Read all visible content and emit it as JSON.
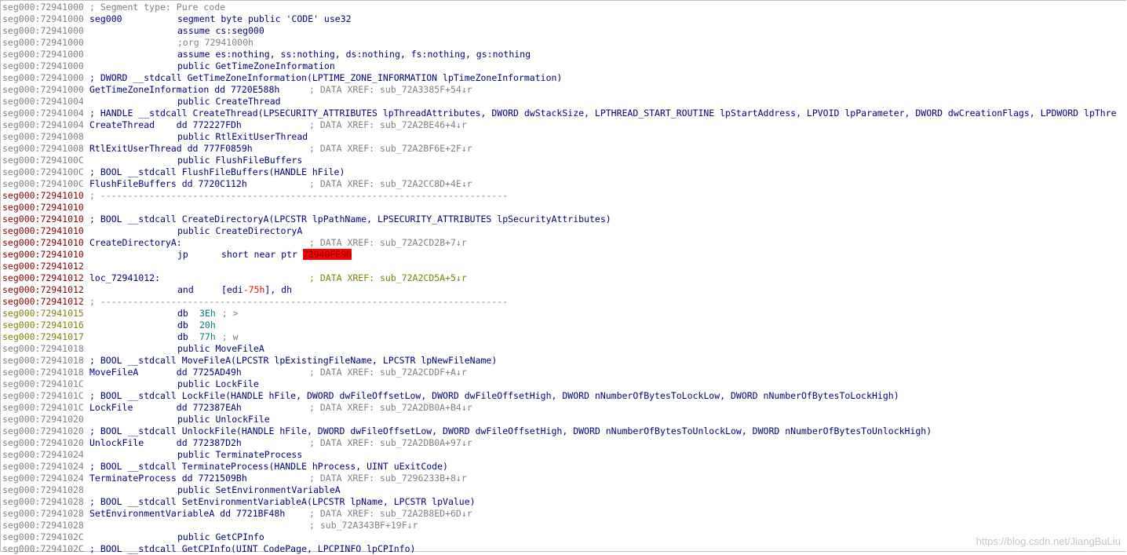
{
  "listing": [
    {
      "addr": "seg000:72941000",
      "kind": "comment",
      "text": "; Segment type: Pure code"
    },
    {
      "addr": "seg000:72941000",
      "kind": "instr",
      "label": "seg000",
      "op": "segment byte public 'CODE' use32",
      "args": ""
    },
    {
      "addr": "seg000:72941000",
      "kind": "instr",
      "label": "",
      "op": "assume cs:seg000",
      "args": ""
    },
    {
      "addr": "seg000:72941000",
      "kind": "instr",
      "label": "",
      "op": ";org 72941000h",
      "args": "",
      "opgray": true
    },
    {
      "addr": "seg000:72941000",
      "kind": "instr",
      "label": "",
      "op": "assume es:nothing, ss:nothing, ds:nothing, fs:nothing, gs:nothing",
      "args": ""
    },
    {
      "addr": "seg000:72941000",
      "kind": "instr",
      "label": "",
      "op": "public GetTimeZoneInformation",
      "args": ""
    },
    {
      "addr": "seg000:72941000",
      "kind": "sig",
      "text": "; DWORD __stdcall GetTimeZoneInformation(LPTIME_ZONE_INFORMATION lpTimeZoneInformation)"
    },
    {
      "addr": "seg000:72941000",
      "kind": "data",
      "label": "GetTimeZoneInformation dd 7720E588h",
      "xref": "; DATA XREF: sub_72A3385F+54↓r"
    },
    {
      "addr": "seg000:72941004",
      "kind": "instr",
      "label": "",
      "op": "public CreateThread",
      "args": ""
    },
    {
      "addr": "seg000:72941004",
      "kind": "sig",
      "text": "; HANDLE __stdcall CreateThread(LPSECURITY_ATTRIBUTES lpThreadAttributes, DWORD dwStackSize, LPTHREAD_START_ROUTINE lpStartAddress, LPVOID lpParameter, DWORD dwCreationFlags, LPDWORD lpThre"
    },
    {
      "addr": "seg000:72941004",
      "kind": "data",
      "label": "CreateThread    dd 772227FDh",
      "xref": "; DATA XREF: sub_72A2BE46+4↓r"
    },
    {
      "addr": "seg000:72941008",
      "kind": "instr",
      "label": "",
      "op": "public RtlExitUserThread",
      "args": ""
    },
    {
      "addr": "seg000:72941008",
      "kind": "data",
      "label": "RtlExitUserThread dd 777F0859h",
      "xref": "; DATA XREF: sub_72A2BF6E+2F↓r"
    },
    {
      "addr": "seg000:7294100C",
      "kind": "instr",
      "label": "",
      "op": "public FlushFileBuffers",
      "args": ""
    },
    {
      "addr": "seg000:7294100C",
      "kind": "sig",
      "text": "; BOOL __stdcall FlushFileBuffers(HANDLE hFile)"
    },
    {
      "addr": "seg000:7294100C",
      "kind": "data",
      "label": "FlushFileBuffers dd 7720C112h",
      "xref": "; DATA XREF: sub_72A2CC8D+4E↓r"
    },
    {
      "addr": "seg000:72941010",
      "kind": "sep",
      "addrclass": "code",
      "text": "; ---------------------------------------------------------------------------"
    },
    {
      "addr": "seg000:72941010",
      "kind": "blank",
      "addrclass": "code"
    },
    {
      "addr": "seg000:72941010",
      "kind": "sig",
      "addrclass": "code",
      "text": "; BOOL __stdcall CreateDirectoryA(LPCSTR lpPathName, LPSECURITY_ATTRIBUTES lpSecurityAttributes)"
    },
    {
      "addr": "seg000:72941010",
      "kind": "instr",
      "addrclass": "code",
      "label": "",
      "op": "public CreateDirectoryA",
      "args": ""
    },
    {
      "addr": "seg000:72941010",
      "kind": "data",
      "addrclass": "code",
      "label": "CreateDirectoryA:",
      "xref": "; DATA XREF: sub_72A2CD2B+7↓r"
    },
    {
      "addr": "seg000:72941010",
      "kind": "jmp",
      "addrclass": "code",
      "op": "jp",
      "args": "short near ptr ",
      "target": "72940FE9h"
    },
    {
      "addr": "seg000:72941012",
      "kind": "blank",
      "addrclass": "code"
    },
    {
      "addr": "seg000:72941012",
      "kind": "data",
      "addrclass": "code",
      "label": "loc_72941012:",
      "xref": "; DATA XREF: sub_72A2CD5A+5↓r",
      "xrefcode": true
    },
    {
      "addr": "seg000:72941012",
      "kind": "jmp",
      "addrclass": "code",
      "op": "and",
      "args": "[edi-75h], dh",
      "argsred": "-75h"
    },
    {
      "addr": "seg000:72941012",
      "kind": "sep",
      "addrclass": "code",
      "text": "; ---------------------------------------------------------------------------"
    },
    {
      "addr": "seg000:72941015",
      "kind": "db",
      "addrclass": "data",
      "op": "db",
      "val": "3Eh",
      "hint": "; >"
    },
    {
      "addr": "seg000:72941016",
      "kind": "db",
      "addrclass": "data",
      "op": "db",
      "val": "20h",
      "hint": ""
    },
    {
      "addr": "seg000:72941017",
      "kind": "db",
      "addrclass": "data",
      "op": "db",
      "val": "77h",
      "hint": "; w"
    },
    {
      "addr": "seg000:72941018",
      "kind": "instr",
      "label": "",
      "op": "public MoveFileA",
      "args": ""
    },
    {
      "addr": "seg000:72941018",
      "kind": "sig",
      "text": "; BOOL __stdcall MoveFileA(LPCSTR lpExistingFileName, LPCSTR lpNewFileName)"
    },
    {
      "addr": "seg000:72941018",
      "kind": "data",
      "label": "MoveFileA       dd 7725AD49h",
      "xref": "; DATA XREF: sub_72A2CDDF+A↓r"
    },
    {
      "addr": "seg000:7294101C",
      "kind": "instr",
      "label": "",
      "op": "public LockFile",
      "args": ""
    },
    {
      "addr": "seg000:7294101C",
      "kind": "sig",
      "text": "; BOOL __stdcall LockFile(HANDLE hFile, DWORD dwFileOffsetLow, DWORD dwFileOffsetHigh, DWORD nNumberOfBytesToLockLow, DWORD nNumberOfBytesToLockHigh)"
    },
    {
      "addr": "seg000:7294101C",
      "kind": "data",
      "label": "LockFile        dd 772387EAh",
      "xref": "; DATA XREF: sub_72A2DB0A+B4↓r"
    },
    {
      "addr": "seg000:72941020",
      "kind": "instr",
      "label": "",
      "op": "public UnlockFile",
      "args": ""
    },
    {
      "addr": "seg000:72941020",
      "kind": "sig",
      "text": "; BOOL __stdcall UnlockFile(HANDLE hFile, DWORD dwFileOffsetLow, DWORD dwFileOffsetHigh, DWORD nNumberOfBytesToUnlockLow, DWORD nNumberOfBytesToUnlockHigh)"
    },
    {
      "addr": "seg000:72941020",
      "kind": "data",
      "label": "UnlockFile      dd 772387D2h",
      "xref": "; DATA XREF: sub_72A2DB0A+97↓r"
    },
    {
      "addr": "seg000:72941024",
      "kind": "instr",
      "label": "",
      "op": "public TerminateProcess",
      "args": ""
    },
    {
      "addr": "seg000:72941024",
      "kind": "sig",
      "text": "; BOOL __stdcall TerminateProcess(HANDLE hProcess, UINT uExitCode)"
    },
    {
      "addr": "seg000:72941024",
      "kind": "data",
      "label": "TerminateProcess dd 7721509Bh",
      "xref": "; DATA XREF: sub_7296233B+8↓r"
    },
    {
      "addr": "seg000:72941028",
      "kind": "instr",
      "label": "",
      "op": "public SetEnvironmentVariableA",
      "args": ""
    },
    {
      "addr": "seg000:72941028",
      "kind": "sig",
      "text": "; BOOL __stdcall SetEnvironmentVariableA(LPCSTR lpName, LPCSTR lpValue)"
    },
    {
      "addr": "seg000:72941028",
      "kind": "data",
      "label": "SetEnvironmentVariableA dd 7721BF48h",
      "xref": "; DATA XREF: sub_72A2B8ED+6D↓r"
    },
    {
      "addr": "seg000:72941028",
      "kind": "data",
      "label": "",
      "xref": "; sub_72A343BF+19F↓r"
    },
    {
      "addr": "seg000:7294102C",
      "kind": "instr",
      "label": "",
      "op": "public GetCPInfo",
      "args": ""
    },
    {
      "addr": "seg000:7294102C",
      "kind": "sig",
      "text": "; BOOL __stdcall GetCPInfo(UINT CodePage, LPCPINFO lpCPInfo)"
    }
  ],
  "watermark": "https://blog.csdn.net/JiangBuLiu"
}
